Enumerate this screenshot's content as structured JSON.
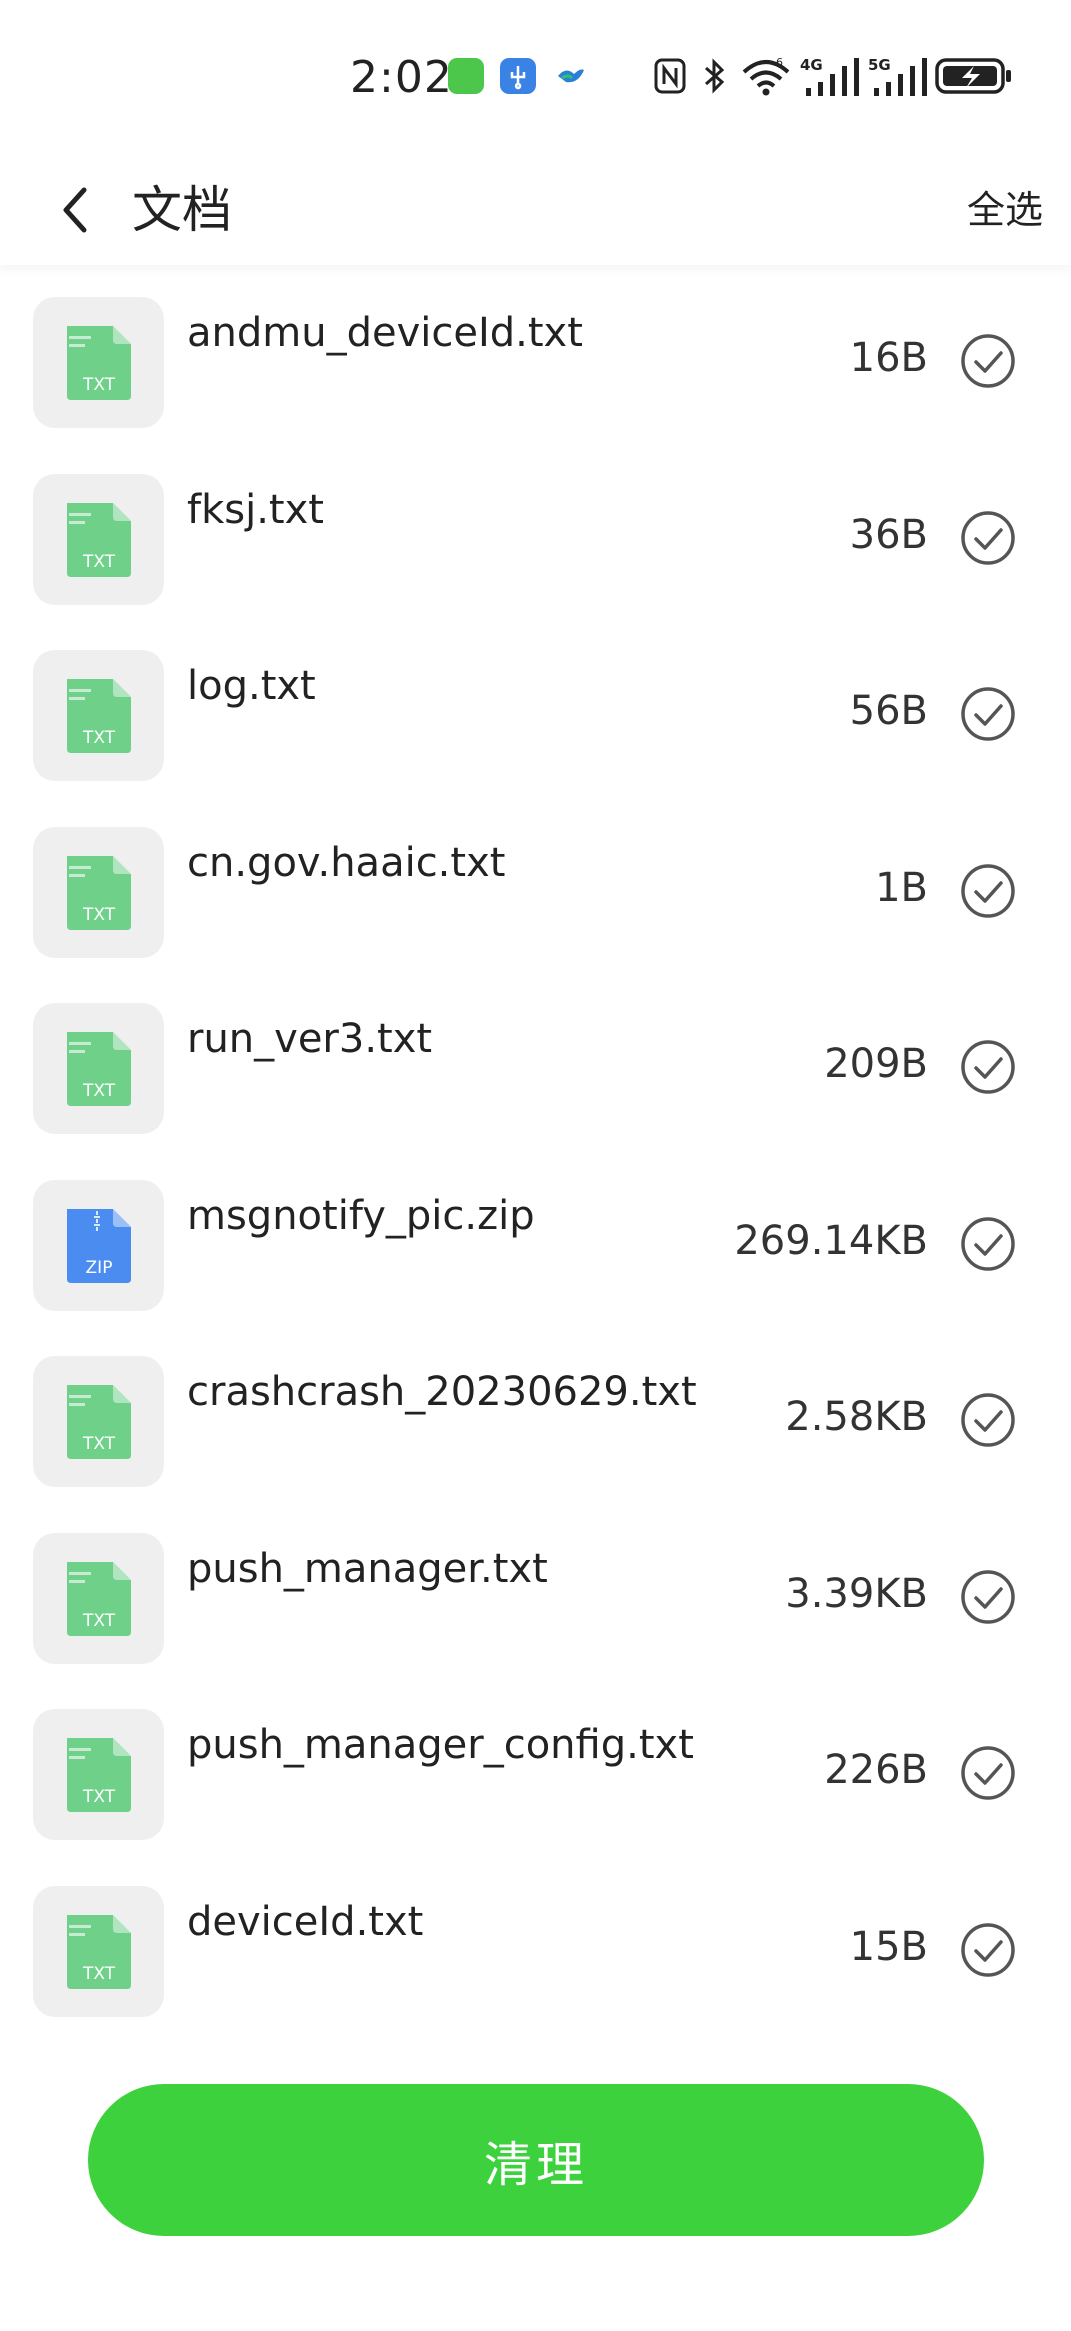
{
  "status_bar": {
    "time": "2:02",
    "network_1": "4G",
    "network_2": "5G",
    "icons": [
      "app-notification-icon",
      "usb-icon",
      "app-bird-icon",
      "nfc-icon",
      "bluetooth-icon",
      "wifi-icon",
      "signal-4g-icon",
      "signal-5g-icon",
      "battery-charging-icon"
    ]
  },
  "header": {
    "back_icon": "chevron-left-icon",
    "title": "文档",
    "select_all": "全选"
  },
  "files": [
    {
      "name": "andmu_deviceId.txt",
      "size": "16B",
      "type": "TXT",
      "checked": true
    },
    {
      "name": "fksj.txt",
      "size": "36B",
      "type": "TXT",
      "checked": true
    },
    {
      "name": "log.txt",
      "size": "56B",
      "type": "TXT",
      "checked": true
    },
    {
      "name": "cn.gov.haaic.txt",
      "size": "1B",
      "type": "TXT",
      "checked": true
    },
    {
      "name": "run_ver3.txt",
      "size": "209B",
      "type": "TXT",
      "checked": true
    },
    {
      "name": "msgnotify_pic.zip",
      "size": "269.14KB",
      "type": "ZIP",
      "checked": true
    },
    {
      "name": "crashcrash_20230629.txt",
      "size": "2.58KB",
      "type": "TXT",
      "checked": true
    },
    {
      "name": "push_manager.txt",
      "size": "3.39KB",
      "type": "TXT",
      "checked": true
    },
    {
      "name": "push_manager_config.txt",
      "size": "226B",
      "type": "TXT",
      "checked": true
    },
    {
      "name": "deviceId.txt",
      "size": "15B",
      "type": "TXT",
      "checked": true
    }
  ],
  "clean_button": "清理",
  "colors": {
    "accent_green": "#3dd13d",
    "txt_icon": "#6fd08a",
    "zip_icon": "#4a8cf0",
    "check_gray": "#555555"
  }
}
